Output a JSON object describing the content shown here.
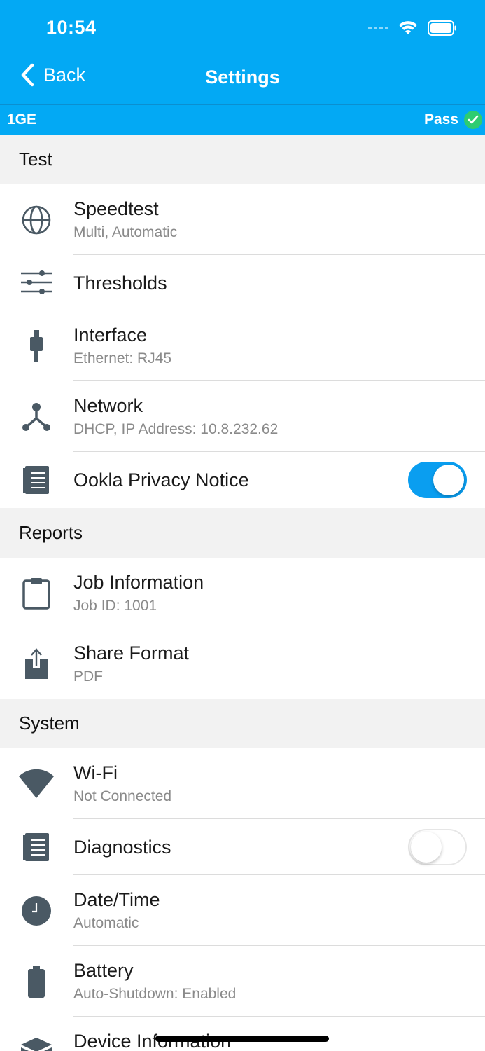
{
  "status_bar": {
    "time": "10:54"
  },
  "nav": {
    "back_label": "Back",
    "title": "Settings"
  },
  "device_bar": {
    "port": "1GE",
    "result": "Pass"
  },
  "colors": {
    "header": "#03a9f4",
    "toggle_on": "#0a9ef0",
    "pass": "#2ecc71",
    "icon": "#4a5964"
  },
  "sections": {
    "test": {
      "label": "Test",
      "items": [
        {
          "title": "Speedtest",
          "subtitle": "Multi, Automatic",
          "icon": "globe-icon"
        },
        {
          "title": "Thresholds",
          "icon": "sliders-icon"
        },
        {
          "title": "Interface",
          "subtitle": "Ethernet: RJ45",
          "icon": "ethernet-plug-icon"
        },
        {
          "title": "Network",
          "subtitle": "DHCP, IP Address: 10.8.232.62",
          "icon": "network-icon"
        },
        {
          "title": "Ookla Privacy Notice",
          "icon": "document-icon",
          "toggle": true
        }
      ]
    },
    "reports": {
      "label": "Reports",
      "items": [
        {
          "title": "Job Information",
          "subtitle": "Job ID: 1001",
          "icon": "clipboard-icon"
        },
        {
          "title": "Share Format",
          "subtitle": "PDF",
          "icon": "share-icon"
        }
      ]
    },
    "system": {
      "label": "System",
      "items": [
        {
          "title": "Wi-Fi",
          "subtitle": "Not Connected",
          "icon": "wifi-icon"
        },
        {
          "title": "Diagnostics",
          "icon": "document-icon",
          "toggle": false
        },
        {
          "title": "Date/Time",
          "subtitle": "Automatic",
          "icon": "clock-icon"
        },
        {
          "title": "Battery",
          "subtitle": "Auto-Shutdown: Enabled",
          "icon": "battery-icon"
        },
        {
          "title": "Device Information",
          "icon": "box-icon"
        }
      ]
    }
  }
}
